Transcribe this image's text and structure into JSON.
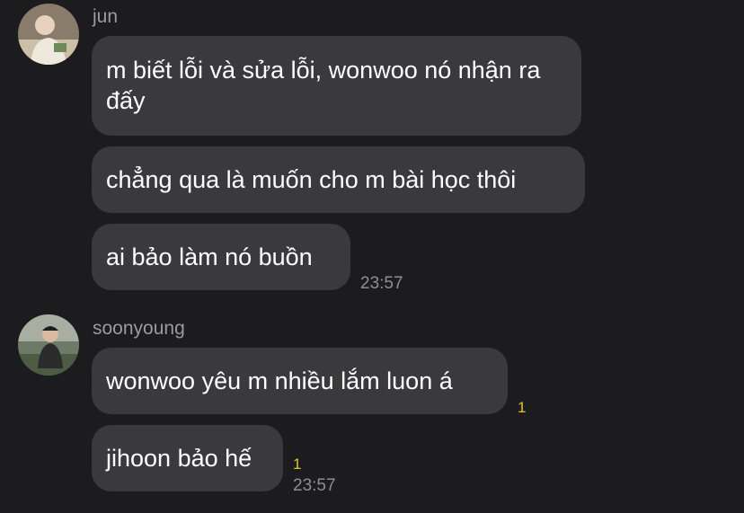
{
  "group1": {
    "sender": "jun",
    "messages": [
      "m biết lỗi và sửa lỗi, wonwoo nó nhận ra đấy",
      "chẳng qua là muốn cho m bài học thôi",
      "ai bảo làm nó buồn"
    ],
    "time": "23:57"
  },
  "group2": {
    "sender": "soonyoung",
    "messages": [
      "wonwoo yêu m nhiều lắm luon á",
      "jihoon bảo hế"
    ],
    "unread": [
      "1",
      "1"
    ],
    "time": "23:57"
  },
  "colors": {
    "background": "#1c1c1e",
    "bubble": "#3a3a3c",
    "unread": "#e8c21c"
  }
}
